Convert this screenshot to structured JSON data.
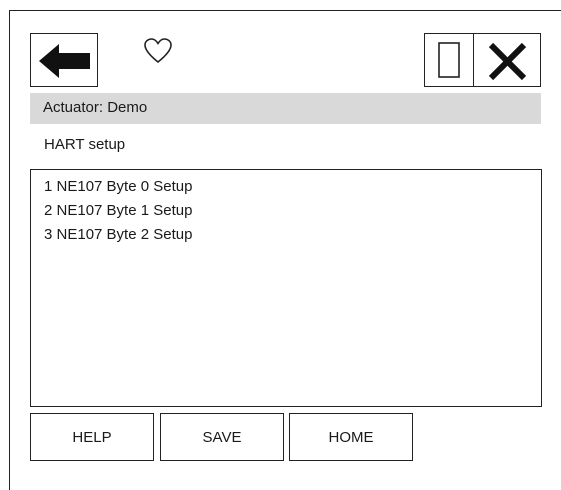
{
  "header": {
    "back_icon": "arrow-left-icon",
    "favorite_icon": "heart-outline-icon",
    "window_icon": "rectangle-icon",
    "close_icon": "close-x-icon"
  },
  "actuator_label": "Actuator: Demo",
  "menu_title": "HART setup",
  "menu_items": [
    "1 NE107 Byte 0 Setup",
    "2 NE107 Byte 1 Setup",
    "3 NE107 Byte 2 Setup"
  ],
  "footer": {
    "help_label": "HELP",
    "save_label": "SAVE",
    "home_label": "HOME"
  }
}
